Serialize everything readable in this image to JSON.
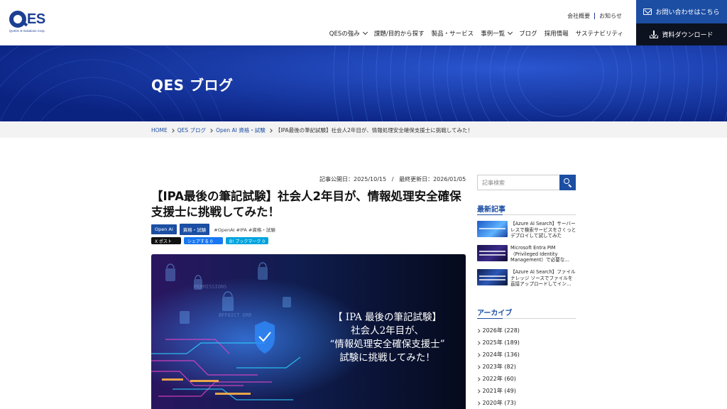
{
  "brand": {
    "logo_text": "ES",
    "logo_sub": "QUICK E-Solutions Corp."
  },
  "utility_nav": {
    "company": "会社概要",
    "news": "お知らせ"
  },
  "global_nav": {
    "items": [
      "QESの強み",
      "課題/目的から探す",
      "製品・サービス",
      "事例一覧",
      "ブログ",
      "採用情報",
      "サステナビリティ"
    ]
  },
  "cta": {
    "contact": "お問い合わせはこちら",
    "download": "資料ダウンロード"
  },
  "hero": {
    "title": "QES ブログ"
  },
  "breadcrumb": {
    "home": "HOME",
    "blog": "QES ブログ",
    "category": "Open AI 資格・試験",
    "current": "【IPA最後の筆記試験】社会人2年目が、情報処理安全確保支援士に挑戦してみた！"
  },
  "article": {
    "published": "記事公開日：2025/10/15",
    "separator": "/",
    "updated": "最終更新日：2026/01/05",
    "title": "【IPA最後の筆記試験】社会人2年目が、情報処理安全確保支援士に挑戦してみた！",
    "tags": [
      "Open AI",
      "資格・試験"
    ],
    "hashtags": "#OpenAI  #IPA  #資格・試験",
    "share": {
      "x": "X ポスト",
      "facebook": "シェアする 0",
      "hatena": "B! ブックマーク 0"
    },
    "eyecatch_lines": [
      "【 IPA 最後の筆記試験】",
      "社会人2年目が、",
      "“情報処理安全確保支援士”",
      "試験に挑戦してみた！"
    ]
  },
  "sidebar": {
    "search_placeholder": "記事検索",
    "recent_heading": "最新記事",
    "recent": [
      "【Azure AI Search】サーバーレスで検索サービスをさくっとデプロイして試してみた",
      "Microsoft Entra PIM（Privileged Identity Management）で必要な…",
      "【Azure AI Search】ファイルナレッジ ソースでファイルを直接アップロードしてイン…"
    ],
    "archive_heading": "アーカイブ",
    "archive": [
      "2026年 (228)",
      "2025年 (189)",
      "2024年 (136)",
      "2023年 (82)",
      "2022年 (60)",
      "2021年 (49)",
      "2020年 (73)"
    ]
  }
}
